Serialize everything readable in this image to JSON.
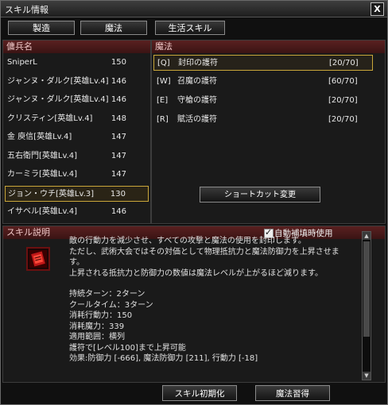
{
  "title": "スキル情報",
  "close_glyph": "X",
  "tabs": [
    {
      "label": "製造"
    },
    {
      "label": "魔法"
    },
    {
      "label": "生活スキル"
    }
  ],
  "mercenary_panel": {
    "header": "傭兵名",
    "items": [
      {
        "name": "SniperL",
        "level": "150"
      },
      {
        "name": "ジャンヌ・ダルク[英雄Lv.4]",
        "level": "146"
      },
      {
        "name": "ジャンヌ・ダルク[英雄Lv.4]",
        "level": "146"
      },
      {
        "name": "クリスティン[英雄Lv.4]",
        "level": "148"
      },
      {
        "name": "金 庾信[英雄Lv.4]",
        "level": "147"
      },
      {
        "name": "五右衛門[英雄Lv.4]",
        "level": "147"
      },
      {
        "name": "カーミラ[英雄Lv.4]",
        "level": "147"
      },
      {
        "name": "ジョン・ウチ[英雄Lv.3]",
        "level": "130"
      },
      {
        "name": "イサベル[英雄Lv.4]",
        "level": "146"
      }
    ]
  },
  "magic_panel": {
    "header": "魔法",
    "items": [
      {
        "key": "[Q]",
        "name": "封印の護符",
        "count": "[20/70]"
      },
      {
        "key": "[W]",
        "name": "召魔の護符",
        "count": "[60/70]"
      },
      {
        "key": "[E]",
        "name": "守槍の護符",
        "count": "[20/70]"
      },
      {
        "key": "[R]",
        "name": "賦活の護符",
        "count": "[20/70]"
      }
    ],
    "shortcut_button": "ショートカット変更"
  },
  "skill_desc": {
    "header": "スキル説明",
    "auto_label": "自動補填時使用",
    "check_glyph": "✓",
    "lines": [
      "敵の行動力を減少させ、すべての攻撃と魔法の使用を封印します。",
      "ただし、武術大会ではその対価として物理抵抗力と魔法防御力を上昇させま",
      "す。",
      "上昇される抵抗力と防御力の数値は魔法レベルが上がるほど減ります。",
      "",
      "持続ターン：2ターン",
      "クールタイム：3ターン",
      "消耗行動力：150",
      "消耗魔力：339",
      "適用範囲：横列",
      "護符で[レベル100]まで上昇可能",
      "効果:防御力 [-666], 魔法防御力 [211], 行動力 [-18]"
    ]
  },
  "footer": {
    "reset_button": "スキル初期化",
    "learn_button": "魔法習得"
  },
  "colors": {
    "accent": "#c9a63a",
    "header_bg": "#4a1a1a"
  }
}
